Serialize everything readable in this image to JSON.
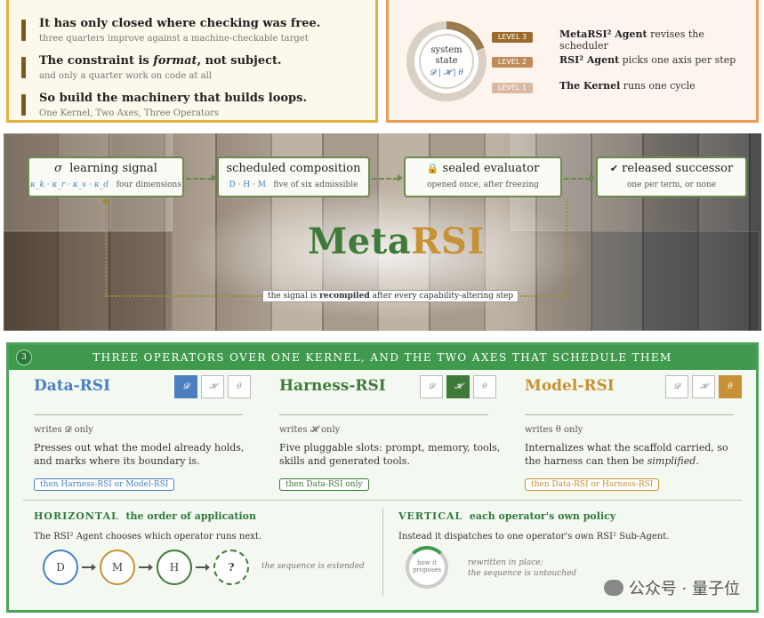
{
  "top_left": {
    "items": [
      {
        "title": "It has only closed where checking was free.",
        "sub": "three quarters improve against a machine-checkable target"
      },
      {
        "title_pre": "The constraint is ",
        "title_em": "format",
        "title_post": ", not subject.",
        "sub": "and only a quarter work on code at all"
      },
      {
        "title": "So build the machinery that builds loops.",
        "sub": "One Kernel, Two Axes, Three Operators"
      }
    ]
  },
  "top_right": {
    "ring": {
      "line1": "system",
      "line2": "state",
      "symbols": "𝓓 | 𝓗 | θ"
    },
    "levels": [
      {
        "tag": "LEVEL 3",
        "name": "MetaRSI² Agent",
        "desc": " revises the scheduler",
        "color": "#9b6a2c"
      },
      {
        "tag": "LEVEL 2",
        "name": "RSI² Agent",
        "desc": " picks one axis per step",
        "color": "#c08a5a"
      },
      {
        "tag": "LEVEL 1",
        "name": "The Kernel",
        "desc": " runs one cycle",
        "color": "#d9b9a3"
      }
    ]
  },
  "banner": {
    "boxes": [
      {
        "icon": "σ",
        "title": "learning signal",
        "sym": "κ_k · κ_r · κ_v · κ_d",
        "sub": "four dimensions"
      },
      {
        "title": "scheduled composition",
        "sym": "D · H · M",
        "sub": "five of six admissible"
      },
      {
        "icon": "🔒",
        "title": "sealed evaluator",
        "sub": "opened once, after freezing"
      },
      {
        "icon": "✔",
        "title": "released successor",
        "sub": "one per term, or none"
      }
    ],
    "brand_a": "Meta",
    "brand_b": "RSI",
    "recompile_pre": "the signal is ",
    "recompile_bold": "recompiled",
    "recompile_post": " after every capability-altering step"
  },
  "bottom": {
    "num": "3",
    "heading": "THREE OPERATORS OVER ONE KERNEL, AND THE TWO AXES THAT SCHEDULE THEM",
    "columns": [
      {
        "title": "Data-RSI",
        "color": "#4a80c0",
        "writes": "writes 𝓓 only",
        "desc": "Presses out what the model already holds, and marks where its boundary is.",
        "then": "then Harness-RSI or Model-RSI",
        "active": 0
      },
      {
        "title": "Harness-RSI",
        "color": "#3f7a3a",
        "writes": "writes 𝓗 only",
        "desc": "Five pluggable slots: prompt, memory, tools, skills and generated tools.",
        "then": "then Data-RSI only",
        "active": 1
      },
      {
        "title": "Model-RSI",
        "color": "#c79235",
        "writes": "writes θ only",
        "desc_pre": "Internalizes what the scaffold carried, so the harness can then be ",
        "desc_em": "simplified",
        "desc_post": ".",
        "then": "then Data-RSI or Harness-RSI",
        "active": 2
      }
    ],
    "icon_labels": [
      "𝓓",
      "𝓗",
      "θ"
    ],
    "horizontal": {
      "cap": "HORIZONTAL",
      "title": "the order of application",
      "body": "The RSI² Agent chooses which operator runs next.",
      "nodes": [
        "D",
        "M",
        "H",
        "?"
      ],
      "note": "the sequence is extended"
    },
    "vertical": {
      "cap": "VERTICAL",
      "title": "each operator's own policy",
      "body": "Instead it dispatches to one operator's own RSI² Sub-Agent.",
      "inner1": "how it",
      "inner2": "proposes",
      "note1": "rewritten in place;",
      "note2": "the sequence is untouched"
    }
  },
  "watermark": "公众号 · 量子位"
}
